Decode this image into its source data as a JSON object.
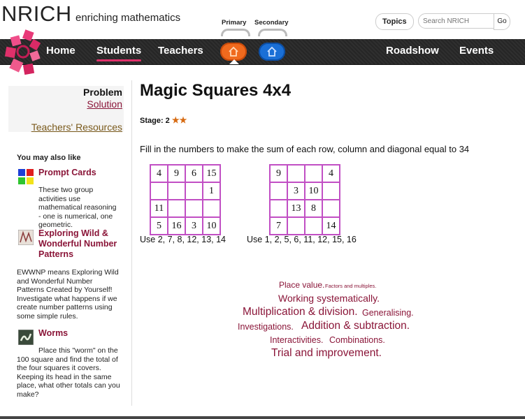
{
  "header": {
    "brand": "NRICH",
    "tagline": "enriching mathematics",
    "topics_label": "Topics",
    "search_placeholder": "Search NRICH",
    "search_go": "Go",
    "primary_label": "Primary",
    "secondary_label": "Secondary"
  },
  "nav": {
    "items": [
      "Home",
      "Students",
      "Teachers",
      "Roadshow",
      "Events"
    ],
    "active": "Students",
    "primary_color": "#f06a1e",
    "secondary_color": "#1a6fd6",
    "accent": "#e0306a"
  },
  "sidebar": {
    "problem": "Problem",
    "solution": "Solution",
    "teachers_resources": "Teachers' Resources",
    "also_like": "You may also like",
    "related": [
      {
        "title": "Prompt Cards",
        "description": "These two group activities use mathematical reasoning - one is numerical, one geometric.",
        "icon": "colored-squares-icon"
      },
      {
        "title": "Exploring Wild & Wonderful Number Patterns",
        "description": "EWWNP means Exploring Wild and Wonderful Number Patterns Created by Yourself! Investigate what happens if we create number patterns using some simple rules.",
        "icon": "number-pattern-icon"
      },
      {
        "title": "Worms",
        "description": "Place this \"worm\" on the 100 square and find the total of the four squares it covers. Keeping its head in the same place, what other totals can you make?",
        "icon": "worm-icon"
      }
    ]
  },
  "main": {
    "title": "Magic Squares 4x4",
    "stage_label": "Stage: 2",
    "stars": 2,
    "instruction": "Fill in the numbers to make the sum of each row, column and diagonal equal to 34",
    "squares": [
      {
        "cells": [
          "4",
          "9",
          "6",
          "15",
          "",
          "",
          "",
          "1",
          "11",
          "",
          "",
          "",
          "5",
          "16",
          "3",
          "10"
        ],
        "use": "Use 2, 7, 8, 12, 13, 14"
      },
      {
        "cells": [
          "9",
          "",
          "",
          "4",
          "",
          "3",
          "10",
          "",
          "",
          "13",
          "8",
          "",
          "7",
          "",
          "",
          "14"
        ],
        "use": "Use 1, 2, 5, 6, 11, 12, 15, 16"
      }
    ],
    "tags": [
      [
        "Place value.",
        "Factors and multiples."
      ],
      [
        "Working systematically."
      ],
      [
        "Multiplication & division.",
        "Generalising."
      ],
      [
        "Investigations.",
        "Addition & subtraction."
      ],
      [
        "Interactivities.",
        "Combinations."
      ],
      [
        "Trial and improvement."
      ]
    ]
  }
}
